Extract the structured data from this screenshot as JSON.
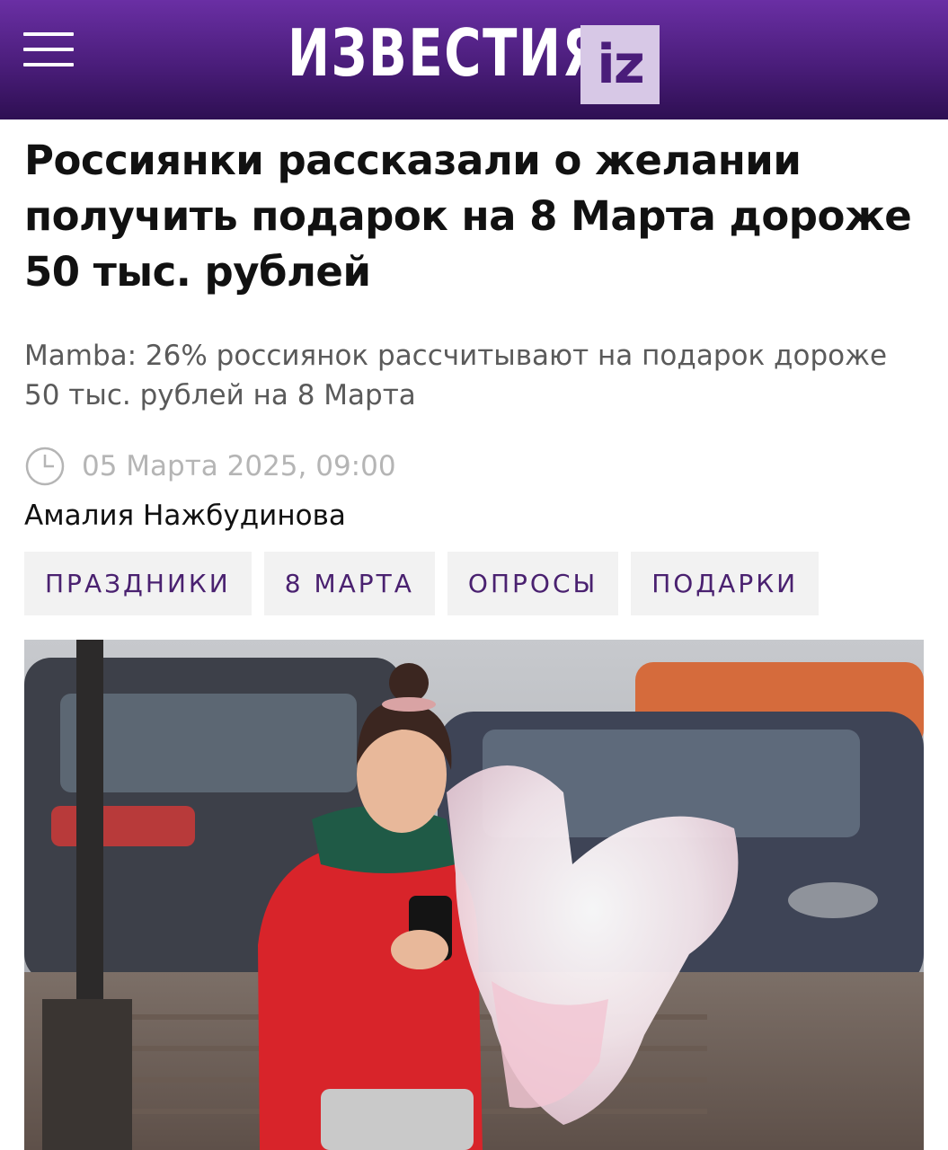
{
  "header": {
    "logo_text": "ИЗВЕСТИЯ",
    "logo_badge": "iz",
    "menu_icon": "hamburger-menu-icon",
    "background_color": "#4a1d7a"
  },
  "article": {
    "title": "Россиянки рассказали о желании получить подарок на 8 Марта дороже 50 тыс. рублей",
    "subtitle": "Mamba: 26% россиянок рассчитывают на подарок дороже 50 тыс. рублей на 8 Марта",
    "date": "05 Марта 2025, 09:00",
    "date_icon": "clock-icon",
    "author": "Амалия Нажбудинова",
    "tags": [
      "ПРАЗДНИКИ",
      "8 МАРТА",
      "ОПРОСЫ",
      "ПОДАРКИ"
    ],
    "tag_color": "#4a2170"
  },
  "photo": {
    "description_icon": "article-photo"
  }
}
